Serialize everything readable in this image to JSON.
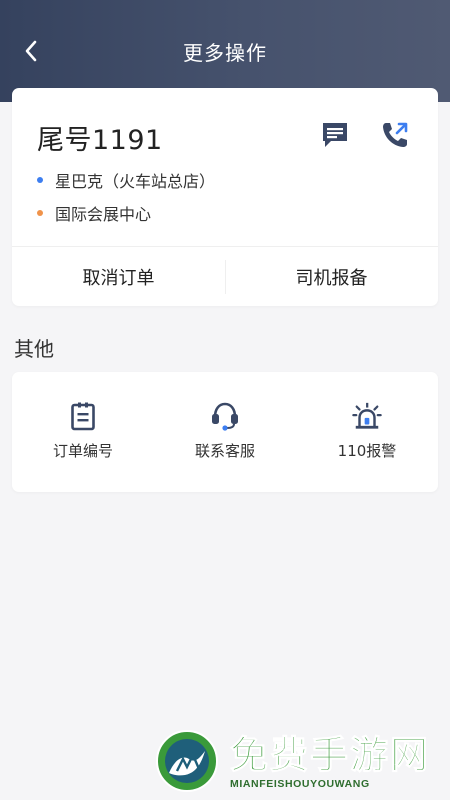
{
  "header": {
    "title": "更多操作",
    "back_icon": "chevron-left-icon"
  },
  "trip": {
    "title": "尾号1191",
    "message_icon": "message-icon",
    "call_icon": "phone-call-icon",
    "from": {
      "label": "星巴克（火车站总店）",
      "dot_color": "#3d7ef0"
    },
    "to": {
      "label": "国际会展中心",
      "dot_color": "#f0934a"
    },
    "actions": {
      "cancel": "取消订单",
      "report": "司机报备"
    }
  },
  "other": {
    "title": "其他",
    "items": [
      {
        "label": "订单编号",
        "icon": "order-clipboard-icon"
      },
      {
        "label": "联系客服",
        "icon": "headset-icon"
      },
      {
        "label": "110报警",
        "icon": "alarm-siren-icon"
      }
    ]
  },
  "watermark": {
    "title": "免费手游网",
    "subtitle": "MIANFEISHOUYOUWANG"
  },
  "colors": {
    "header_start": "#35425e",
    "header_end": "#505a73",
    "icon_primary": "#3a4866",
    "watermark_green": "#3a9a3a"
  }
}
